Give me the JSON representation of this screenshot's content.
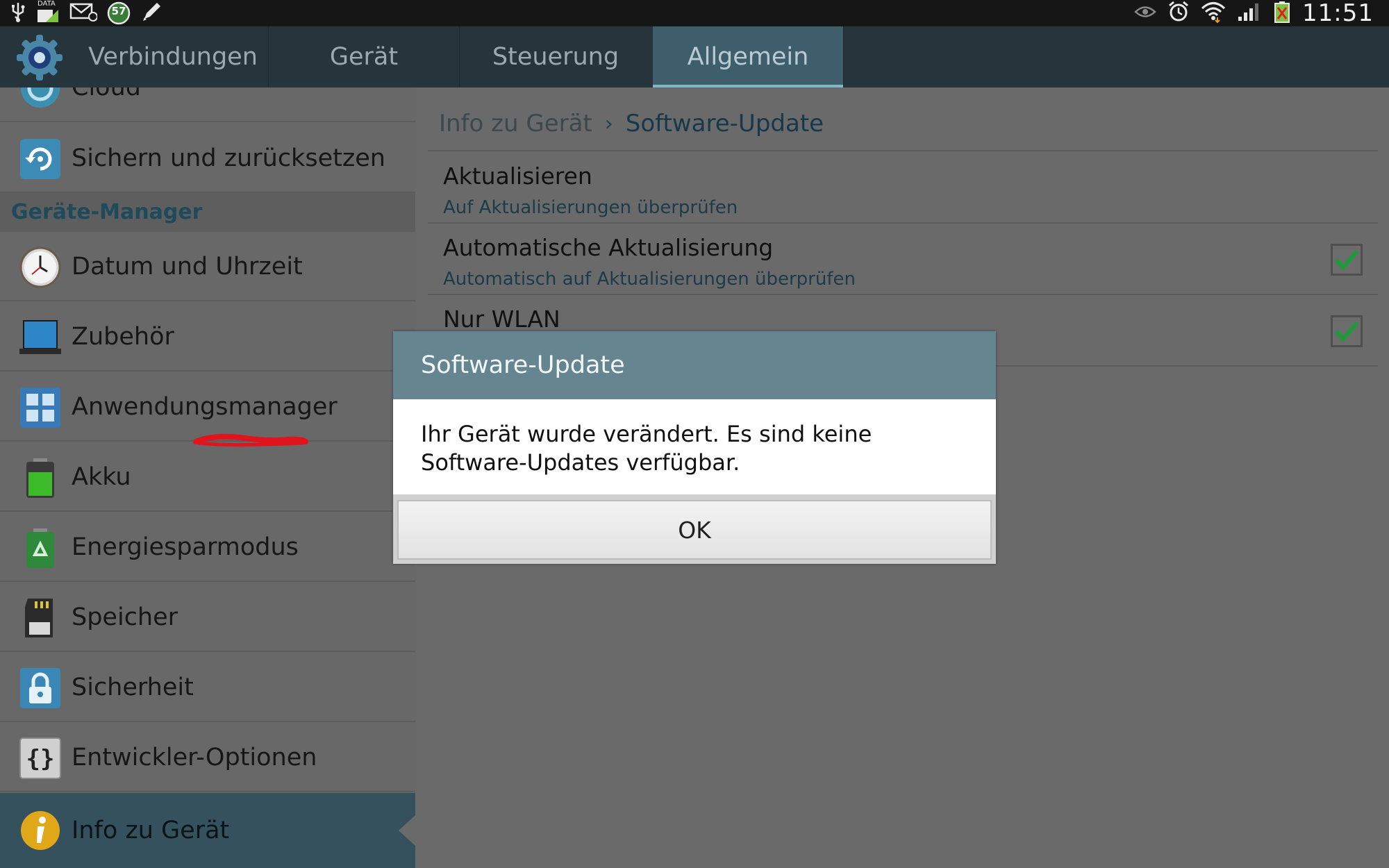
{
  "status_bar": {
    "time": "11:51",
    "data_label": "DATA",
    "notification_count": "57",
    "left_icons": [
      "usb-icon",
      "data-signal-icon",
      "email-icon",
      "notification-counter-icon",
      "pen-icon"
    ],
    "right_icons": [
      "eye-icon",
      "alarm-icon",
      "wifi-icon",
      "signal-icon",
      "battery-icon"
    ]
  },
  "tabs": [
    {
      "label": "Verbindungen",
      "active": false
    },
    {
      "label": "Gerät",
      "active": false
    },
    {
      "label": "Steuerung",
      "active": false
    },
    {
      "label": "Allgemein",
      "active": true
    }
  ],
  "sidebar": {
    "items": [
      {
        "label": "Cloud",
        "icon": "cloud-icon"
      },
      {
        "label": "Sichern und zurücksetzen",
        "icon": "backup-icon"
      },
      {
        "header": "Geräte-Manager"
      },
      {
        "label": "Datum und Uhrzeit",
        "icon": "clock-icon"
      },
      {
        "label": "Zubehör",
        "icon": "accessory-icon"
      },
      {
        "label": "Anwendungsmanager",
        "icon": "app-grid-icon"
      },
      {
        "label": "Akku",
        "icon": "battery-icon"
      },
      {
        "label": "Energiesparmodus",
        "icon": "power-saving-icon"
      },
      {
        "label": "Speicher",
        "icon": "sd-card-icon"
      },
      {
        "label": "Sicherheit",
        "icon": "lock-icon"
      },
      {
        "label": "Entwickler-Optionen",
        "icon": "braces-icon"
      },
      {
        "label": "Info zu Gerät",
        "icon": "info-icon",
        "selected": true
      }
    ]
  },
  "breadcrumb": {
    "parent": "Info zu Gerät",
    "current": "Software-Update"
  },
  "settings": [
    {
      "title": "Aktualisieren",
      "subtitle": "Auf Aktualisierungen überprüfen"
    },
    {
      "title": "Automatische Aktualisierung",
      "subtitle": "Automatisch auf Aktualisierungen überprüfen",
      "checked": true
    },
    {
      "title": "Nur WLAN",
      "subtitle": "",
      "checked": true
    }
  ],
  "dialog": {
    "title": "Software-Update",
    "message": "Ihr Gerät wurde verändert. Es sind keine Software-Updates verfügbar.",
    "ok_label": "OK"
  },
  "colors": {
    "tab_active": "#3f5e6c",
    "accent_text": "#17384a",
    "dialog_header": "#658591",
    "check_green": "#1f9a3a",
    "scribble": "#e0141c"
  }
}
